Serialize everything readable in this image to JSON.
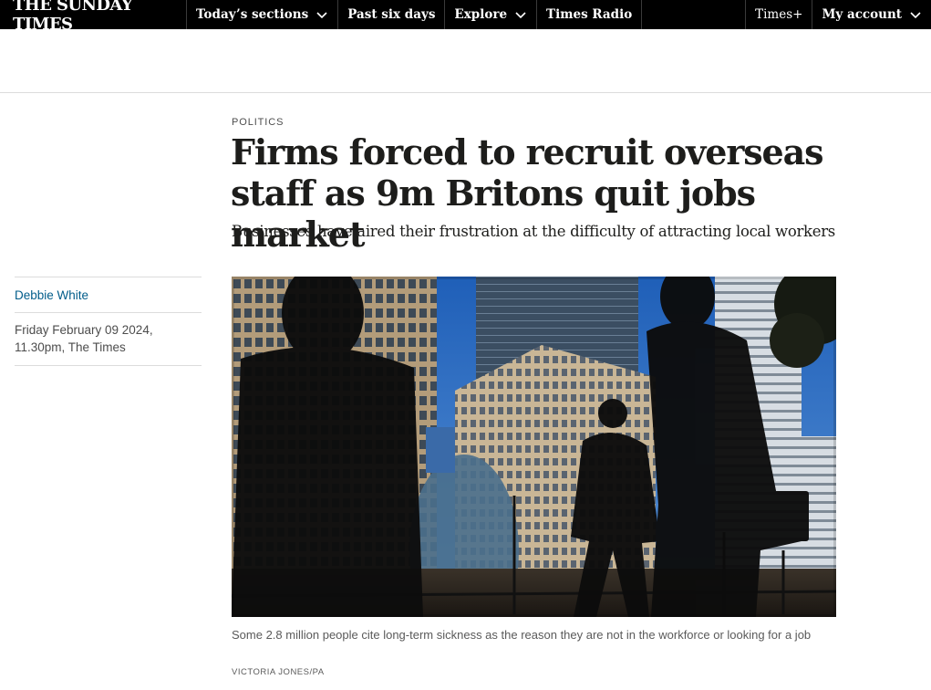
{
  "nav": {
    "logo": "THE SUNDAY TIMES",
    "items": [
      {
        "label": "Today’s sections",
        "has_chevron": true
      },
      {
        "label": "Past six days",
        "has_chevron": false
      },
      {
        "label": "Explore",
        "has_chevron": true
      },
      {
        "label": "Times Radio",
        "has_chevron": false
      }
    ],
    "right_items": [
      {
        "label": "Times+",
        "has_chevron": false
      },
      {
        "label": "My account",
        "has_chevron": true
      }
    ]
  },
  "article": {
    "section": "POLITICS",
    "headline": "Firms forced to recruit overseas staff as 9m Britons quit jobs market",
    "standfirst": "Businesses have aired their frustration at the difficulty of attracting local workers",
    "author": "Debbie White",
    "date_line_1": "Friday February 09 2024,",
    "date_line_2": "11.30pm, The Times",
    "image": {
      "caption": "Some 2.8 million people cite long-term sickness as the reason they are not in the workforce or looking for a job",
      "credit": "VICTORIA JONES/PA"
    }
  },
  "colors": {
    "nav_bg": "#000000",
    "author_link": "#005c8a",
    "sky": "#3f7fd0"
  }
}
